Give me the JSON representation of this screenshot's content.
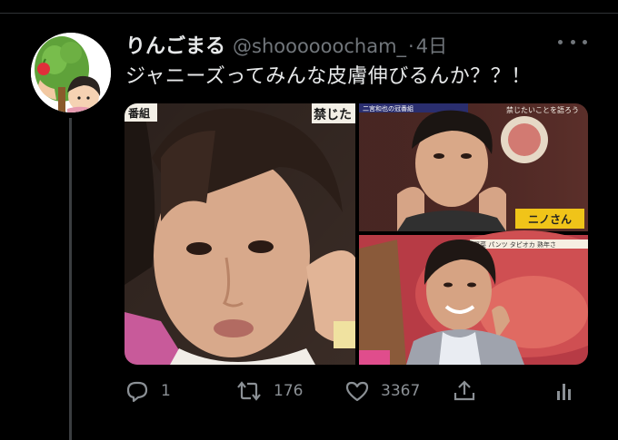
{
  "tweet": {
    "display_name": "りんごまる",
    "handle": "@shoooooocham_",
    "separator": "·",
    "time": "4日",
    "text": "ジャニーズってみんな皮膚伸びるんか？？！",
    "media": [
      {
        "name": "left-photo",
        "caption_right": "禁じた",
        "caption_left": "番組"
      },
      {
        "name": "top-right-photo",
        "caption_top": "二宮和也の冠番組",
        "caption_right": "禁じたいことを語ろう",
        "badge": "ニノさん"
      },
      {
        "name": "bottom-right-photo",
        "ticker": "野菜 パンツ タピオカ 熟年さ"
      }
    ],
    "actions": {
      "reply": {
        "icon": "reply-icon",
        "count": "1"
      },
      "retweet": {
        "icon": "retweet-icon",
        "count": "176"
      },
      "like": {
        "icon": "heart-icon",
        "count": "3367"
      },
      "share": {
        "icon": "share-icon"
      },
      "analytics": {
        "icon": "analytics-icon"
      }
    }
  },
  "colors": {
    "background": "#000000",
    "text": "#e7e9ea",
    "secondary": "#71767b",
    "divider": "#2f3336"
  }
}
